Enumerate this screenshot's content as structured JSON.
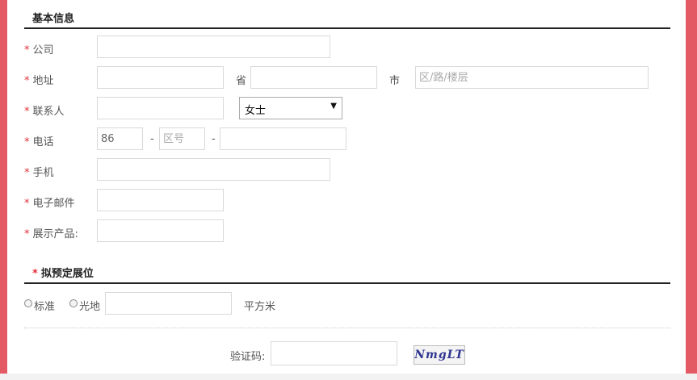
{
  "sections": {
    "basic_info": "基本信息",
    "booth": "拟预定展位"
  },
  "required_mark": "*",
  "fields": {
    "company": {
      "label": "公司"
    },
    "address": {
      "label": "地址",
      "province_label": "省",
      "city_label": "市",
      "district_placeholder": "区/路/楼层"
    },
    "contact": {
      "label": "联系人",
      "title_selected": "女士"
    },
    "phone": {
      "label": "电话",
      "country_code": "86",
      "area_placeholder": "区号",
      "separator": "-"
    },
    "mobile": {
      "label": "手机"
    },
    "email": {
      "label": "电子邮件"
    },
    "products": {
      "label": "展示产品:"
    }
  },
  "booth": {
    "option_standard": "标准",
    "option_raw": "光地",
    "unit": "平方米"
  },
  "captcha": {
    "label": "验证码:",
    "image_text": "NmgLT"
  },
  "colors": {
    "accent_border": "#e45a64",
    "required": "#e0303a"
  }
}
